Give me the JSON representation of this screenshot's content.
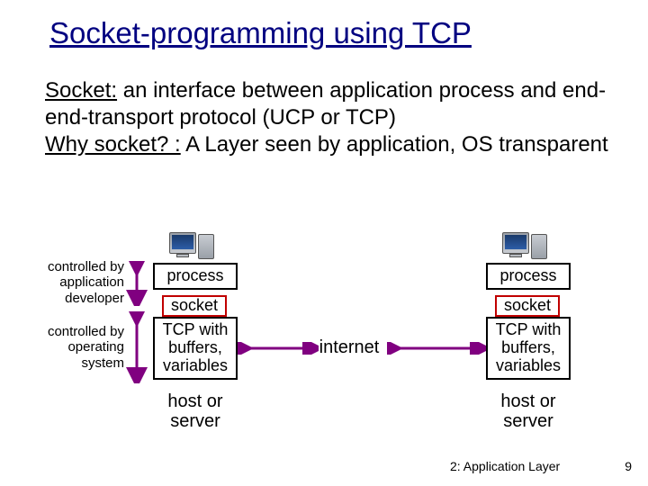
{
  "title": "Socket-programming using TCP",
  "para1_label": "Socket:",
  "para1_text": " an interface between application process and end-end-transport protocol (UCP or TCP)",
  "para2_label": "Why socket? :",
  "para2_text": " A Layer seen by application, OS transparent",
  "left_label_top_l1": "controlled by",
  "left_label_top_l2": "application",
  "left_label_top_l3": "developer",
  "left_label_bot_l1": "controlled by",
  "left_label_bot_l2": "operating",
  "left_label_bot_l3": "system",
  "box_process": "process",
  "box_socket": "socket",
  "box_tcp_l1": "TCP with",
  "box_tcp_l2": "buffers,",
  "box_tcp_l3": "variables",
  "internet": "internet",
  "caption_l1": "host or",
  "caption_l2": "server",
  "footer_chapter": "2: Application Layer",
  "footer_page": "9"
}
